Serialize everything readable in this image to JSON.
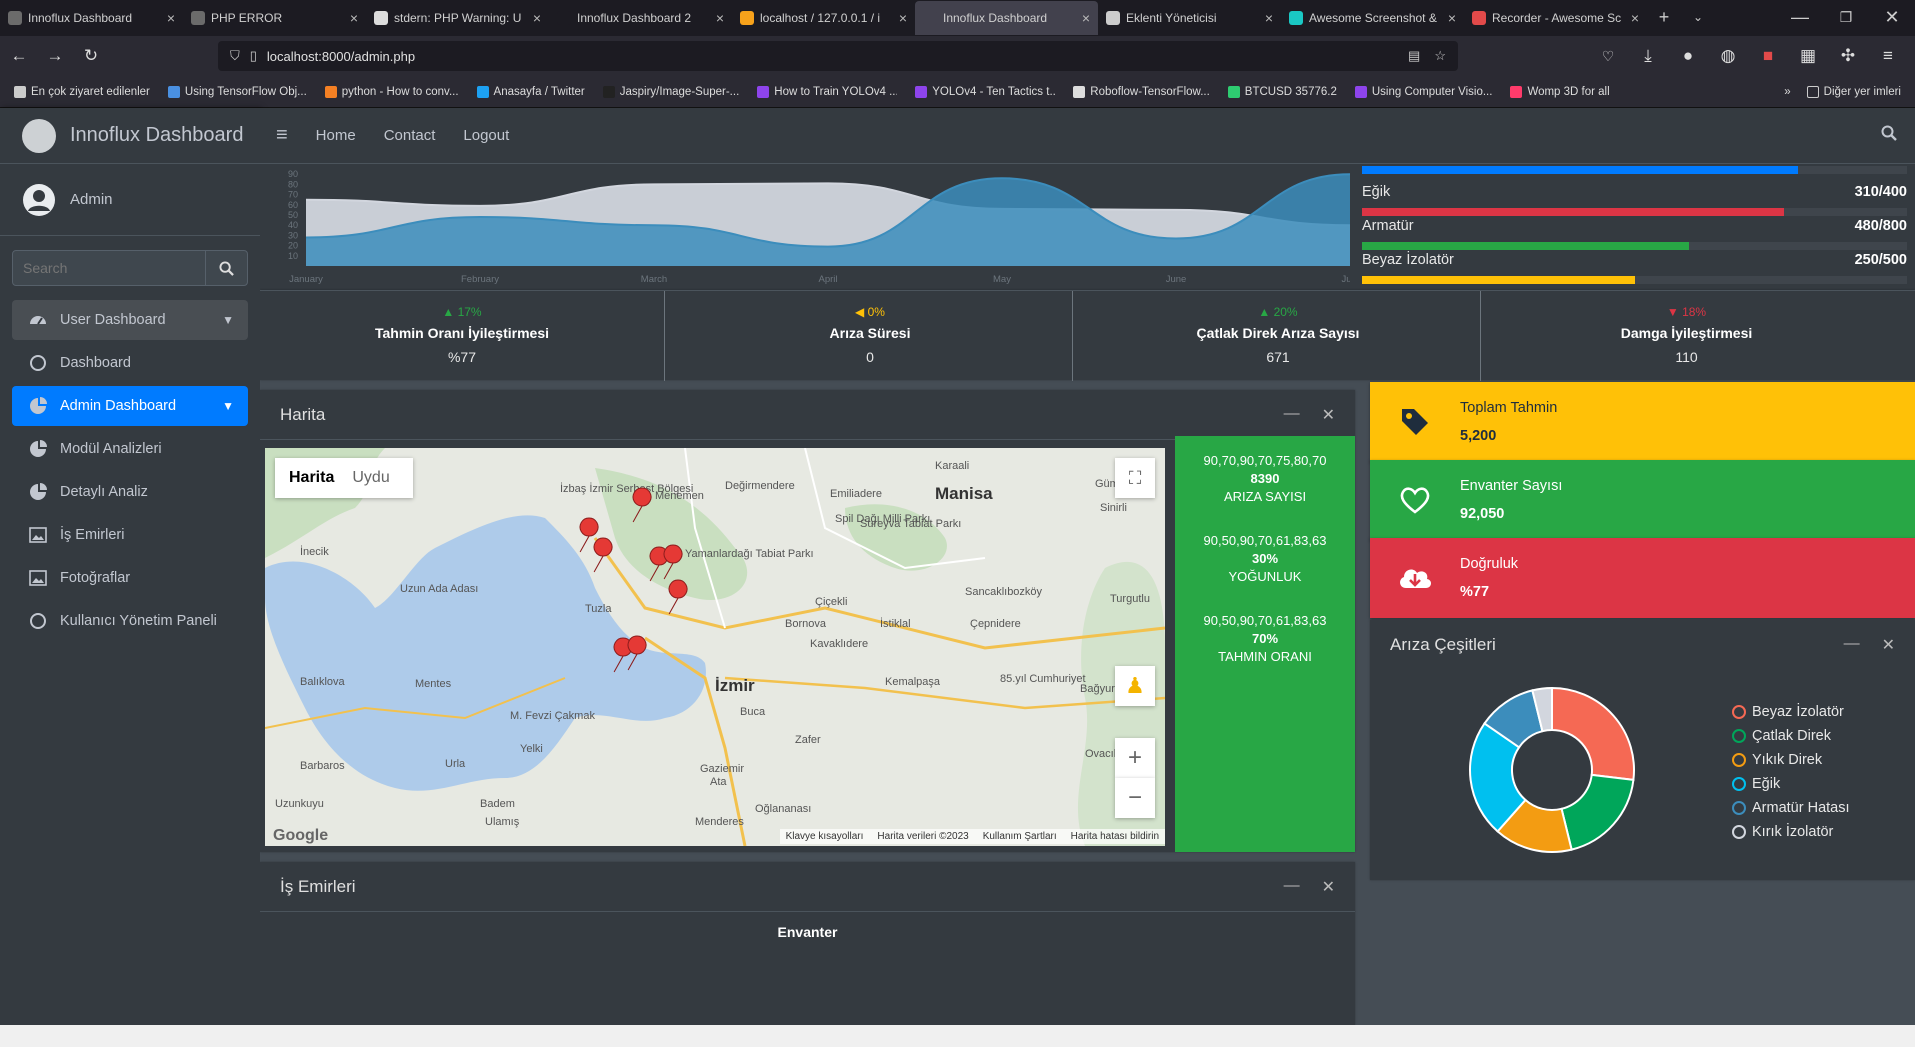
{
  "browser": {
    "tabs": [
      {
        "title": "Innoflux Dashboard",
        "color": "#6b6b6b",
        "active": false
      },
      {
        "title": "PHP ERROR",
        "color": "#6b6b6b",
        "active": false
      },
      {
        "title": "stdern: PHP Warning: U",
        "color": "#dddddd",
        "active": false
      },
      {
        "title": "Innoflux Dashboard 2",
        "color": "#1c1b22",
        "active": false
      },
      {
        "title": "localhost / 127.0.0.1 / i",
        "color": "#f7a21b",
        "active": false
      },
      {
        "title": "Innoflux Dashboard",
        "color": "#42414d",
        "active": true
      },
      {
        "title": "Eklenti Yöneticisi",
        "color": "#cccccc",
        "active": false
      },
      {
        "title": "Awesome Screenshot &",
        "color": "#1ac8c4",
        "active": false
      },
      {
        "title": "Recorder - Awesome Sc",
        "color": "#e24a4a",
        "active": false
      }
    ],
    "url": "localhost:8000/admin.php",
    "bookmarks": [
      {
        "label": "En çok ziyaret edilenler",
        "color": "#cccccc"
      },
      {
        "label": "Using TensorFlow Obj...",
        "color": "#4a90e2"
      },
      {
        "label": "python - How to conv...",
        "color": "#f48024"
      },
      {
        "label": "Anasayfa / Twitter",
        "color": "#1da1f2"
      },
      {
        "label": "Jaspiry/Image-Super-...",
        "color": "#222222"
      },
      {
        "label": "How to Train YOLOv4 ...",
        "color": "#8e44ec"
      },
      {
        "label": "YOLOv4 - Ten Tactics t...",
        "color": "#8e44ec"
      },
      {
        "label": "Roboflow-TensorFlow...",
        "color": "#dddddd"
      },
      {
        "label": "BTCUSD 35776.2",
        "color": "#2ecc71"
      },
      {
        "label": "Using Computer Visio...",
        "color": "#8e44ec"
      },
      {
        "label": "Womp 3D for all",
        "color": "#ff3b6b"
      }
    ],
    "other_bookmarks": "Diğer yer imleri"
  },
  "app": {
    "brand": "Innoflux Dashboard",
    "user": "Admin",
    "search_placeholder": "Search",
    "nav": [
      {
        "label": "User Dashboard",
        "icon": "gauge-icon",
        "state": "open",
        "chevron": true
      },
      {
        "label": "Dashboard",
        "icon": "circle-icon",
        "state": "",
        "chevron": false
      },
      {
        "label": "Admin Dashboard",
        "icon": "pie-chart-icon",
        "state": "active",
        "chevron": true
      },
      {
        "label": "Modül Analizleri",
        "icon": "pie-chart-icon",
        "state": "",
        "chevron": false
      },
      {
        "label": "Detaylı Analiz",
        "icon": "pie-chart-icon",
        "state": "",
        "chevron": false
      },
      {
        "label": "İş Emirleri",
        "icon": "image-icon",
        "state": "",
        "chevron": false
      },
      {
        "label": "Fotoğraflar",
        "icon": "image-icon",
        "state": "",
        "chevron": false
      },
      {
        "label": "Kullanıcı Yönetim Paneli",
        "icon": "circle-icon",
        "state": "",
        "chevron": false
      }
    ],
    "topnav": [
      "Home",
      "Contact",
      "Logout"
    ]
  },
  "chart_data": [
    {
      "type": "area",
      "x": [
        "January",
        "February",
        "March",
        "April",
        "May",
        "June",
        "July"
      ],
      "series": [
        {
          "values": [
            65,
            59,
            80,
            81,
            56,
            55,
            40
          ],
          "color": "#d2d6de"
        },
        {
          "values": [
            28,
            48,
            40,
            19,
            86,
            27,
            90
          ],
          "color": "#3c8dbc"
        }
      ],
      "yticks": [
        "90",
        "80",
        "70",
        "60",
        "50",
        "40",
        "30",
        "20",
        "10"
      ],
      "ylim": [
        0,
        100
      ]
    },
    {
      "type": "pie",
      "title": "Arıza Çeşitleri",
      "labels": [
        "Beyaz İzolatör",
        "Çatlak Direk",
        "Yıkık Direk",
        "Eğik",
        "Armatür Hatası",
        "Kırık İzolatör"
      ],
      "values": [
        700,
        500,
        400,
        600,
        300,
        100
      ],
      "colors": [
        "#f56954",
        "#00a65a",
        "#f39c12",
        "#00c0ef",
        "#3c8dbc",
        "#d2d6de"
      ]
    }
  ],
  "progress": [
    {
      "label": "Eğik",
      "value": "310/400",
      "fraction": 0.775,
      "color": "#dc3545"
    },
    {
      "label": "Armatür",
      "value": "480/800",
      "fraction": 0.6,
      "color": "#28a745"
    },
    {
      "label": "Beyaz İzolatör",
      "value": "250/500",
      "fraction": 0.5,
      "color": "#ffc107"
    }
  ],
  "top_bar_fraction": 0.8,
  "stats": [
    {
      "pct": "▲ 17%",
      "pct_color": "#28a745",
      "label": "Tahmin Oranı İyileştirmesi",
      "value": "%77"
    },
    {
      "pct": "◀ 0%",
      "pct_color": "#ffc107",
      "label": "Arıza Süresi",
      "value": "0"
    },
    {
      "pct": "▲ 20%",
      "pct_color": "#28a745",
      "label": "Çatlak Direk Arıza Sayısı",
      "value": "671"
    },
    {
      "pct": "▼ 18%",
      "pct_color": "#dc3545",
      "label": "Damga İyileştirmesi",
      "value": "110"
    }
  ],
  "map_card": {
    "title": "Harita",
    "map_type_options": [
      "Harita",
      "Uydu"
    ],
    "places": [
      "Manisa",
      "İzmir",
      "Menemen",
      "Tuzla",
      "Buca",
      "Gaziemir",
      "Kemalpaşa",
      "Turgutlu",
      "Sancaklıbozköy",
      "Bornova",
      "Çiçekli",
      "Urla",
      "Balıklova",
      "Barbaros",
      "Uzunkuyu",
      "Yelki",
      "Mentes",
      "İnecik",
      "Badem",
      "Ulamış",
      "Menderes",
      "Ata",
      "Zafer",
      "Oğlananası",
      "Kavaklıdere",
      "İstiklal",
      "Çepnidere",
      "Emiliadere",
      "Değirmendere",
      "Karaali",
      "Sinirli",
      "Gümüldür",
      "Bağyurdu",
      "Ovacık",
      "Spil Dağı Milli Parkı",
      "Yamanlardağı Tabiat Parkı",
      "Sureyva Tabiat Parkı",
      "Uzun Ada Adası",
      "İzbaş İzmir Serbest Bölgesi",
      "85.yıl Cumhuriyet",
      "M. Fevzi Çakmak"
    ],
    "footer": [
      "Google",
      "Klavye kısayolları",
      "Harita verileri ©2023",
      "Kullanım Şartları",
      "Harita hatası bildirin"
    ],
    "stats_panel": [
      {
        "spark": "90,70,90,70,75,80,70",
        "value": "8390",
        "label": "ARIZA SAYISI"
      },
      {
        "spark": "90,50,90,70,61,83,63",
        "value": "30%",
        "label": "YOĞUNLUK"
      },
      {
        "spark": "90,50,90,70,61,83,63",
        "value": "70%",
        "label": "TAHMIN ORANI"
      }
    ]
  },
  "info_boxes": [
    {
      "label": "Toplam Tahmin",
      "value": "5,200",
      "bg": "#ffc107",
      "fg": "#1f2d3d",
      "icon": "tag-icon"
    },
    {
      "label": "Envanter Sayısı",
      "value": "92,050",
      "bg": "#28a745",
      "fg": "#ffffff",
      "icon": "heart-icon"
    },
    {
      "label": "Doğruluk",
      "value": "%77",
      "bg": "#dc3545",
      "fg": "#ffffff",
      "icon": "cloud-download-icon"
    }
  ],
  "work_orders": {
    "title": "İş Emirleri",
    "sub": "Envanter"
  }
}
